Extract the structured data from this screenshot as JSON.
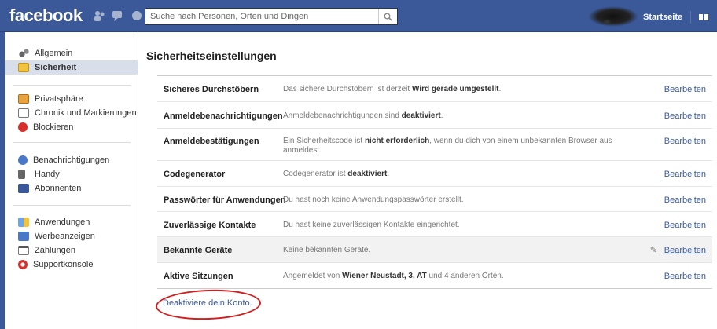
{
  "header": {
    "logo": "facebook",
    "search_placeholder": "Suche nach Personen, Orten und Dingen",
    "home_link": "Startseite"
  },
  "sidebar": {
    "group1": [
      {
        "label": "Allgemein",
        "icon": "gears-icon"
      },
      {
        "label": "Sicherheit",
        "icon": "shield-icon",
        "selected": true
      }
    ],
    "group2": [
      {
        "label": "Privatsphäre",
        "icon": "lock-icon"
      },
      {
        "label": "Chronik und Markierungen",
        "icon": "timeline-icon"
      },
      {
        "label": "Blockieren",
        "icon": "block-icon"
      }
    ],
    "group3": [
      {
        "label": "Benachrichtigungen",
        "icon": "globe-icon"
      },
      {
        "label": "Handy",
        "icon": "mobile-icon"
      },
      {
        "label": "Abonnenten",
        "icon": "rss-icon"
      }
    ],
    "group4": [
      {
        "label": "Anwendungen",
        "icon": "apps-icon"
      },
      {
        "label": "Werbeanzeigen",
        "icon": "ads-icon"
      },
      {
        "label": "Zahlungen",
        "icon": "payment-icon"
      },
      {
        "label": "Supportkonsole",
        "icon": "support-icon"
      }
    ]
  },
  "main": {
    "title": "Sicherheitseinstellungen",
    "edit_label": "Bearbeiten",
    "rows": [
      {
        "label": "Sicheres Durchstöbern",
        "value_pre": "Das sichere Durchstöbern ist derzeit ",
        "value_bold": "Wird gerade umgestellt",
        "value_post": "."
      },
      {
        "label": "Anmeldebenachrichtigungen",
        "value_pre": "Anmeldebenachrichtigungen sind ",
        "value_bold": "deaktiviert",
        "value_post": "."
      },
      {
        "label": "Anmeldebestätigungen",
        "value_pre": "Ein Sicherheitscode ist ",
        "value_bold": "nicht erforderlich",
        "value_post": ", wenn du dich von einem unbekannten Browser aus anmeldest."
      },
      {
        "label": "Codegenerator",
        "value_pre": "Codegenerator ist ",
        "value_bold": "deaktiviert",
        "value_post": "."
      },
      {
        "label": "Passwörter für Anwendungen",
        "value_pre": "Du hast noch keine Anwendungspasswörter erstellt.",
        "value_bold": "",
        "value_post": ""
      },
      {
        "label": "Zuverlässige Kontakte",
        "value_pre": "Du hast keine zuverlässigen Kontakte eingerichtet.",
        "value_bold": "",
        "value_post": ""
      },
      {
        "label": "Bekannte Geräte",
        "value_pre": "Keine bekannten Geräte.",
        "value_bold": "",
        "value_post": "",
        "highlighted": true
      },
      {
        "label": "Aktive Sitzungen",
        "value_pre": "Angemeldet von ",
        "value_bold": "Wiener Neustadt, 3, AT",
        "value_post": " und 4 anderen Orten."
      }
    ],
    "deactivate_link": "Deaktiviere dein Konto."
  },
  "colors": {
    "brand": "#3b5998",
    "annotation_red": "#d21d1d",
    "selected_bg": "#d8dfea"
  }
}
